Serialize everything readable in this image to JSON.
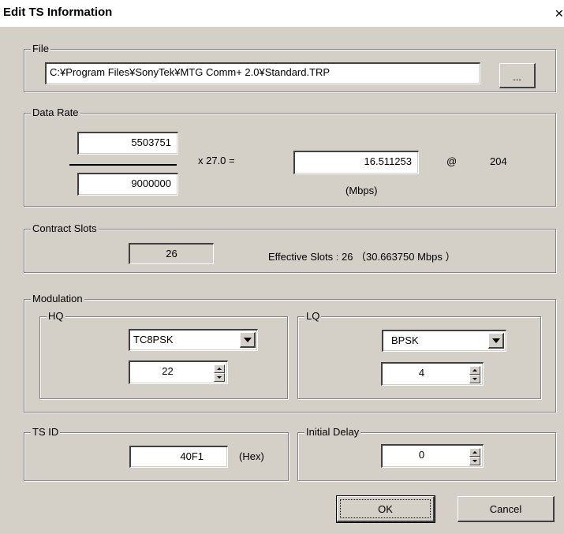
{
  "window": {
    "title": "Edit TS Information",
    "close_glyph": "✕"
  },
  "file": {
    "group_label": "File",
    "path": "C:¥Program Files¥SonyTek¥MTG Comm+ 2.0¥Standard.TRP",
    "browse_label": "..."
  },
  "data_rate": {
    "group_label": "Data Rate",
    "numerator": "5503751",
    "denominator": "9000000",
    "multiplier_text": "x  27.0  =",
    "result": "16.511253",
    "unit": "(Mbps)",
    "at_symbol": "@",
    "packet_size": "204"
  },
  "contract_slots": {
    "group_label": "Contract Slots",
    "value": "26",
    "effective_text": "Effective Slots : 26 （30.663750 Mbps ）"
  },
  "modulation": {
    "group_label": "Modulation",
    "hq": {
      "label": "HQ",
      "scheme": "TC8PSK",
      "slots": "22"
    },
    "lq": {
      "label": "LQ",
      "scheme": "BPSK",
      "slots": "4"
    }
  },
  "ts_id": {
    "group_label": "TS ID",
    "value": "40F1",
    "unit": "(Hex)"
  },
  "initial_delay": {
    "group_label": "Initial Delay",
    "value": "0"
  },
  "buttons": {
    "ok_label": "OK",
    "cancel_label": "Cancel"
  }
}
